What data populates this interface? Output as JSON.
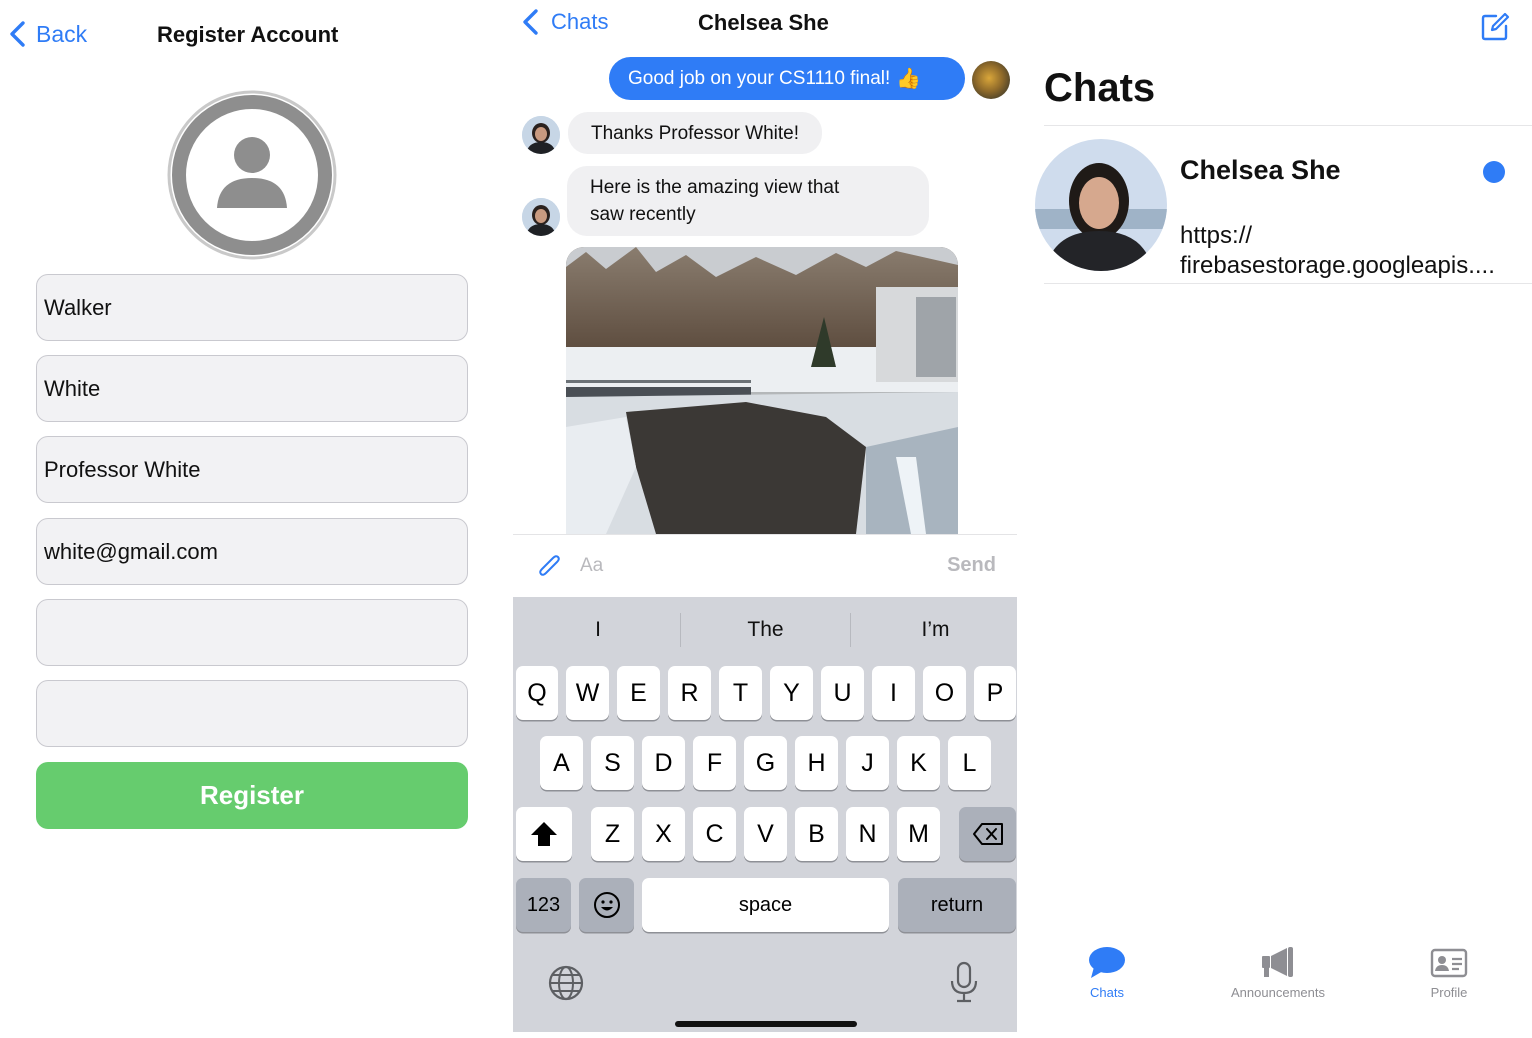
{
  "register": {
    "back_label": "Back",
    "title": "Register Account",
    "fields": [
      {
        "value": "Walker"
      },
      {
        "value": "White"
      },
      {
        "value": "Professor White"
      },
      {
        "value": "white@gmail.com"
      },
      {
        "value": ""
      },
      {
        "value": ""
      }
    ],
    "register_label": "Register"
  },
  "chat": {
    "back_label": "Chats",
    "title": "Chelsea She",
    "messages": [
      {
        "from": "me",
        "text": "Good job on your CS1110 final!",
        "emoji": "👍"
      },
      {
        "from": "them",
        "text": "Thanks Professor White!"
      },
      {
        "from": "them",
        "text_line1": "Here is the amazing view that",
        "text_line2": "saw recently"
      }
    ],
    "composer": {
      "placeholder": "Aa",
      "send_label": "Send"
    },
    "keyboard": {
      "suggestions": [
        "I",
        "The",
        "I’m"
      ],
      "row1": [
        "Q",
        "W",
        "E",
        "R",
        "T",
        "Y",
        "U",
        "I",
        "O",
        "P"
      ],
      "row2": [
        "A",
        "S",
        "D",
        "F",
        "G",
        "H",
        "J",
        "K",
        "L"
      ],
      "row3": [
        "Z",
        "X",
        "C",
        "V",
        "B",
        "N",
        "M"
      ],
      "numbers_label": "123",
      "space_label": "space",
      "return_label": "return"
    }
  },
  "chats_list": {
    "title": "Chats",
    "items": [
      {
        "name": "Chelsea She",
        "preview_line1": "https://",
        "preview_line2": "firebasestorage.googleapis....",
        "unread": true
      }
    ],
    "tabs": [
      {
        "label": "Chats",
        "active": true
      },
      {
        "label": "Announcements",
        "active": false
      },
      {
        "label": "Profile",
        "active": false
      }
    ]
  },
  "colors": {
    "accent": "#2f7cf6",
    "register_green": "#66cc6e",
    "bubble_in": "#f0f0f2",
    "keyboard_bg": "#d2d4da"
  }
}
